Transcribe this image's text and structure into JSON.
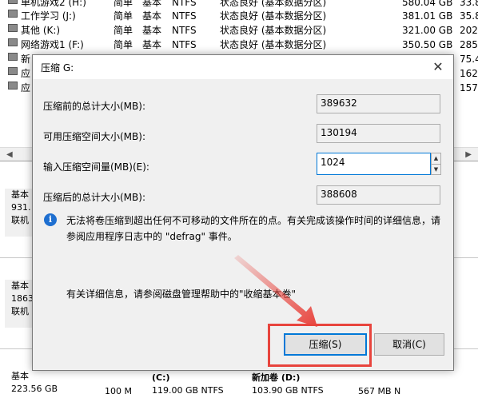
{
  "volumes": [
    {
      "name": "单机游戏2 (H:)",
      "layout": "简单",
      "type": "基本",
      "fs": "NTFS",
      "status": "状态良好 (基本数据分区)",
      "capacity": "580.04 GB",
      "free": "33.8"
    },
    {
      "name": "工作学习 (J:)",
      "layout": "简单",
      "type": "基本",
      "fs": "NTFS",
      "status": "状态良好 (基本数据分区)",
      "capacity": "381.01 GB",
      "free": "35.8"
    },
    {
      "name": "其他 (K:)",
      "layout": "简单",
      "type": "基本",
      "fs": "NTFS",
      "status": "状态良好 (基本数据分区)",
      "capacity": "321.00 GB",
      "free": "202."
    },
    {
      "name": "网络游戏1 (F:)",
      "layout": "简单",
      "type": "基本",
      "fs": "NTFS",
      "status": "状态良好 (基本数据分区)",
      "capacity": "350.50 GB",
      "free": "285."
    },
    {
      "name": "新",
      "layout": "",
      "type": "",
      "fs": "",
      "status": "",
      "capacity": "",
      "free": "75.4"
    },
    {
      "name": "应",
      "layout": "",
      "type": "",
      "fs": "",
      "status": "",
      "capacity": "",
      "free": "162."
    },
    {
      "name": "应",
      "layout": "",
      "type": "",
      "fs": "",
      "status": "",
      "capacity": "",
      "free": "157."
    }
  ],
  "disks": [
    {
      "kind": "基本",
      "size": "931.",
      "state": "联机"
    },
    {
      "kind": "基本",
      "size": "1863",
      "state": "联机"
    },
    {
      "kind": "基本",
      "size": "223.56 GB",
      "state": ""
    }
  ],
  "bottom_partitions": [
    {
      "label": "",
      "size": "100 M"
    },
    {
      "label": "(C:)",
      "size": "119.00 GB NTFS"
    },
    {
      "label": "新加卷 (D:)",
      "size": "103.90 GB NTFS"
    },
    {
      "label": "",
      "size": "567 MB N"
    }
  ],
  "dialog": {
    "title": "压缩 G:",
    "close_glyph": "✕",
    "fields": [
      {
        "label": "压缩前的总计大小(MB):",
        "value": "389632"
      },
      {
        "label": "可用压缩空间大小(MB):",
        "value": "130194"
      },
      {
        "label": "输入压缩空间量(MB)(E):",
        "value": "1024"
      },
      {
        "label": "压缩后的总计大小(MB):",
        "value": "388608"
      }
    ],
    "info_icon": "i",
    "info_text": "无法将卷压缩到超出任何不可移动的文件所在的点。有关完成该操作时间的详细信息，请参阅应用程序日志中的 \"defrag\" 事件。",
    "help_text": "有关详细信息，请参阅磁盘管理帮助中的\"收缩基本卷\"",
    "shrink_button": "压缩(S)",
    "cancel_button": "取消(C)"
  },
  "colors": {
    "highlight": "#e8443d",
    "accent": "#0078d7",
    "partition_bar": "#1f3f8f"
  }
}
